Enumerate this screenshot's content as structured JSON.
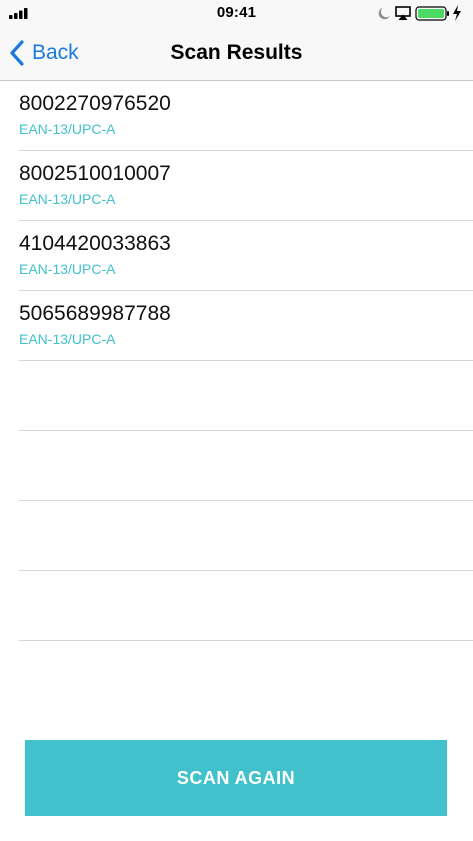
{
  "status_bar": {
    "time": "09:41",
    "icons": [
      "signal-bars-icon",
      "moon-icon",
      "airplay-icon",
      "battery-icon",
      "charging-bolt-icon"
    ]
  },
  "nav": {
    "back_label": "Back",
    "title": "Scan Results",
    "back_icon": "chevron-left-icon"
  },
  "results": [
    {
      "code": "8002270976520",
      "type": "EAN-13/UPC-A"
    },
    {
      "code": "8002510010007",
      "type": "EAN-13/UPC-A"
    },
    {
      "code": "4104420033863",
      "type": "EAN-13/UPC-A"
    },
    {
      "code": "5065689987788",
      "type": "EAN-13/UPC-A"
    }
  ],
  "actions": {
    "scan_again_label": "SCAN AGAIN"
  },
  "colors": {
    "accent": "#40c1cc",
    "link": "#1a7ae0",
    "battery": "#4cd964"
  }
}
